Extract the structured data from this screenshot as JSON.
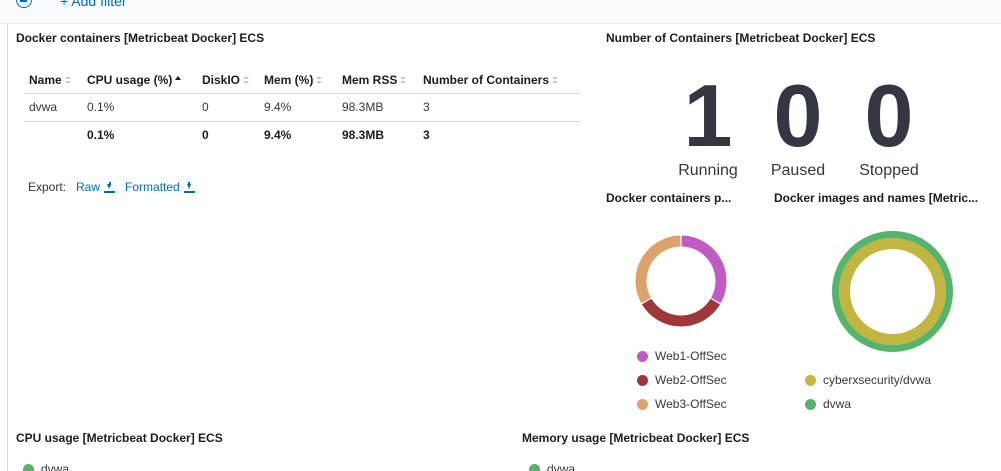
{
  "filter_bar": {
    "add_filter_label": "+ Add filter"
  },
  "table_panel": {
    "title": "Docker containers [Metricbeat Docker] ECS",
    "columns": [
      "Name",
      "CPU usage (%)",
      "DiskIO",
      "Mem (%)",
      "Mem RSS",
      "Number of Containers"
    ],
    "sorted_column": "CPU usage (%)",
    "rows": [
      [
        "dvwa",
        "0.1%",
        "0",
        "9.4%",
        "98.3MB",
        "3"
      ]
    ],
    "totals": [
      "",
      "0.1%",
      "0",
      "9.4%",
      "98.3MB",
      "3"
    ],
    "export_label": "Export:",
    "export_raw": "Raw",
    "export_formatted": "Formatted"
  },
  "containers_panel": {
    "title": "Number of Containers [Metricbeat Docker] ECS",
    "metrics": [
      {
        "value": "1",
        "label": "Running"
      },
      {
        "value": "0",
        "label": "Paused"
      },
      {
        "value": "0",
        "label": "Stopped"
      }
    ]
  },
  "donut_left": {
    "title": "Docker containers p...",
    "slices": [
      {
        "name": "Web1-OffSec",
        "color": "#c05ac4",
        "value": 1
      },
      {
        "name": "Web2-OffSec",
        "color": "#a0353a",
        "value": 1
      },
      {
        "name": "Web3-OffSec",
        "color": "#dda16a",
        "value": 1
      }
    ]
  },
  "donut_right": {
    "title": "Docker images and names [Metric...",
    "rings": [
      {
        "name": "cyberxsecurity/dvwa",
        "color": "#c3b640",
        "value": 1
      },
      {
        "name": "dvwa",
        "color": "#54b36c",
        "value": 1
      }
    ]
  },
  "cpu_panel": {
    "title": "CPU usage [Metricbeat Docker] ECS",
    "legend": "dvwa",
    "legend_color": "#54b36c"
  },
  "mem_panel": {
    "title": "Memory usage [Metricbeat Docker] ECS",
    "legend": "dvwa",
    "legend_color": "#54b36c"
  }
}
